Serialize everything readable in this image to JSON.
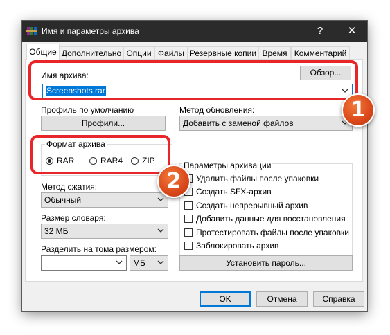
{
  "window": {
    "title": "Имя и параметры архива",
    "help_label": "?",
    "close_label": "✕"
  },
  "tabs": [
    {
      "label": "Общие",
      "active": true
    },
    {
      "label": "Дополнительно"
    },
    {
      "label": "Опции"
    },
    {
      "label": "Файлы"
    },
    {
      "label": "Резервные копии"
    },
    {
      "label": "Время"
    },
    {
      "label": "Комментарий"
    }
  ],
  "archive_name": {
    "label": "Имя архива:",
    "browse_label": "Обзор...",
    "value": "Screenshots.rar"
  },
  "profile": {
    "label": "Профиль по умолчанию",
    "button_label": "Профили..."
  },
  "update_method": {
    "label": "Метод обновления:",
    "value": "Добавить с заменой файлов"
  },
  "archive_format": {
    "title": "Формат архива",
    "options": [
      "RAR",
      "RAR4",
      "ZIP"
    ],
    "selected": "RAR"
  },
  "compression": {
    "label": "Метод сжатия:",
    "value": "Обычный"
  },
  "dictionary": {
    "label": "Размер словаря:",
    "value": "32 МБ"
  },
  "split": {
    "label": "Разделить на тома размером:",
    "value": "",
    "unit": "МБ"
  },
  "archive_options": {
    "title": "Параметры архивации",
    "items": [
      {
        "label": "Удалить файлы после упаковки",
        "checked": false
      },
      {
        "label": "Создать SFX-архив",
        "checked": false
      },
      {
        "label": "Создать непрерывный архив",
        "checked": false
      },
      {
        "label": "Добавить данные для восстановления",
        "checked": false
      },
      {
        "label": "Протестировать файлы после упаковки",
        "checked": false
      },
      {
        "label": "Заблокировать архив",
        "checked": false
      }
    ]
  },
  "password_button": "Установить пароль...",
  "footer": {
    "ok": "OK",
    "cancel": "Отмена",
    "help": "Справка"
  },
  "badges": [
    "1",
    "2"
  ],
  "colors": {
    "title_bar": "#2b2b2b",
    "callout": "#e8262a",
    "badge": "#d9471a",
    "selection": "#0078d7"
  }
}
